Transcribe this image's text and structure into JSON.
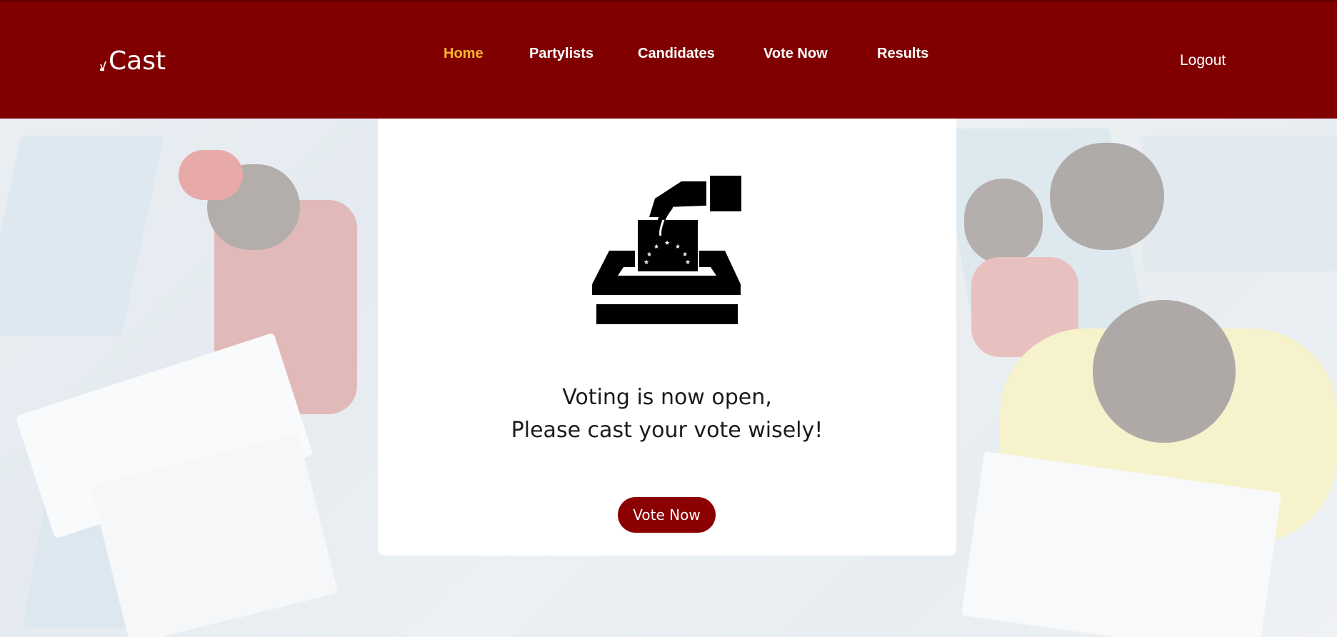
{
  "brand": {
    "logo_text": "Cast",
    "colors": {
      "header": "#800000",
      "active_nav": "#f6b531",
      "button": "#8b0000"
    }
  },
  "nav": {
    "items": [
      {
        "label": "Home",
        "active": true
      },
      {
        "label": "Partylists",
        "active": false
      },
      {
        "label": "Candidates",
        "active": false
      },
      {
        "label": "Vote Now",
        "active": false
      },
      {
        "label": "Results",
        "active": false
      }
    ],
    "logout_label": "Logout"
  },
  "main": {
    "icon": "ballot-box-icon",
    "message_line1": "Voting is now open,",
    "message_line2": "Please cast your vote wisely!",
    "button_label": "Vote Now"
  }
}
